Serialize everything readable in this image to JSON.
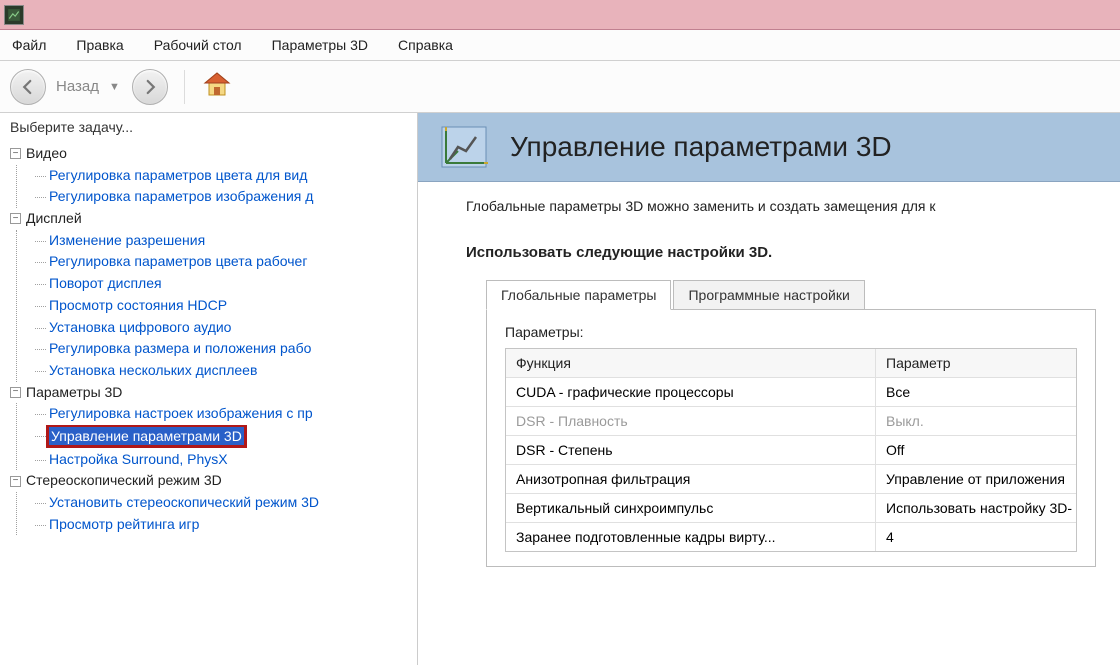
{
  "menubar": {
    "items": [
      "Файл",
      "Правка",
      "Рабочий стол",
      "Параметры 3D",
      "Справка"
    ]
  },
  "toolbar": {
    "back_label": "Назад"
  },
  "sidebar": {
    "title": "Выберите задачу...",
    "groups": [
      {
        "label": "Видео",
        "items": [
          "Регулировка параметров цвета для вид",
          "Регулировка параметров изображения д"
        ]
      },
      {
        "label": "Дисплей",
        "items": [
          "Изменение разрешения",
          "Регулировка параметров цвета рабочег",
          "Поворот дисплея",
          "Просмотр состояния HDCP",
          "Установка цифрового аудио",
          "Регулировка размера и положения рабо",
          "Установка нескольких дисплеев"
        ]
      },
      {
        "label": "Параметры 3D",
        "items": [
          "Регулировка настроек изображения с пр",
          "Управление параметрами 3D",
          "Настройка Surround, PhysX"
        ],
        "selected_index": 1
      },
      {
        "label": "Стереоскопический режим 3D",
        "items": [
          "Установить стереоскопический режим 3D",
          "Просмотр рейтинга игр"
        ]
      }
    ]
  },
  "content": {
    "title": "Управление параметрами 3D",
    "intro": "Глобальные параметры 3D можно заменить и создать замещения для к",
    "section_title": "Использовать следующие настройки 3D.",
    "tabs": [
      "Глобальные параметры",
      "Программные настройки"
    ],
    "active_tab": 0,
    "params_label": "Параметры:",
    "table": {
      "headers": [
        "Функция",
        "Параметр"
      ],
      "rows": [
        {
          "func": "CUDA - графические процессоры",
          "param": "Все",
          "disabled": false
        },
        {
          "func": "DSR - Плавность",
          "param": "Выкл.",
          "disabled": true
        },
        {
          "func": "DSR - Степень",
          "param": "Off",
          "disabled": false
        },
        {
          "func": "Анизотропная фильтрация",
          "param": "Управление от приложения",
          "disabled": false
        },
        {
          "func": "Вертикальный синхроимпульс",
          "param": "Использовать настройку 3D-",
          "disabled": false
        },
        {
          "func": "Заранее подготовленные кадры вирту...",
          "param": "4",
          "disabled": false
        }
      ]
    }
  }
}
